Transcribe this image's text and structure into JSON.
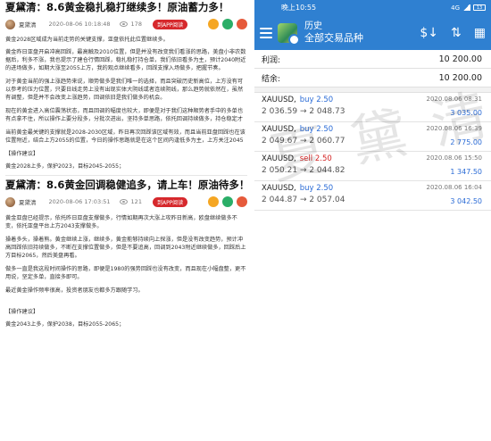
{
  "articles": [
    {
      "title": "夏黛清：8.6黄金稳扎稳打继续多！原油蓄力多！",
      "author": "夏黛清",
      "time": "2020-08-06 10:18:48",
      "views": "178",
      "app_label": "到APP阅读",
      "paragraphs": [
        "黄金2028区域成为当前走势的关键支撑，亚盘依托此位置继续多。",
        "黄金昨日亚盘开启冲高回踩，最高触及2010位置，但是并没有改变我们看涨的思路，美盘小非农数据后，利多不涨，我也提示了建仓行情回踩，稳扎稳打持仓单，我们依旧看多为主，预计2040附近的进场做多，如期大涨至2055上方，我的观点继续看多，回踩支撑入场做多，把握节奏。",
        "对于黄金当前的强上涨趋势来说，顺势做多是我们唯一的选择，而且突破历史新高位，上方没有可以参考的压力位置，只要日线走势上没有出现实体大阴线或者连续阴线，那么趋势就依然在，虽然有调整，但是并不会改变上涨趋势，回调依旧是我们做多的机会。",
        "现在的黄金进入高位震荡状态，而且回调的幅度也较大，即便是对于我们这种顺势者手中的多单也有点拿不住，所以操作上要分段多，分批次进出，坚持多单思路，依托回调持续做多，持仓稳定才能保证盈利稳定。",
        "当前黄金最关键的支撑就是2028-2030区域，昨日再次回踩该区域有效，而且当前亚盘回踩也在该位置附近，结合上方2055的位置，今日的操作思路就是在这个区间内逢低多为主，上方关注2045和2055压力。"
      ],
      "suggestion_label": "【操作建议】",
      "suggestion": "黄金2028上多，保护2023，目标2045-2055；"
    },
    {
      "title": "夏黛清：8.6黄金回调稳健追多，请上车！原油待多！",
      "author": "夏黛清",
      "time": "2020-08-06 17:03:51",
      "views": "121",
      "app_label": "到APP阅读",
      "paragraphs": [
        "黄金亚盘已经提示，依托昨日亚盘支撑做多，行情如期再次大涨上攻昨日新高，欧盘继续做多不变，依托亚盘平台上方2043支撑做多。",
        "操着多头，操着熊。黄金继续上涨，继续多，黄金能够持续向上探涨，但是没有改变趋势，预计冲高回踩依旧持续做多，不断在支撑位置做多，但是不要追高，回调到2043附近继续做多，回踩后上方目标2065，然后美盘再看。",
        "做多一直是我这段时间操作的思路，即便是1980的强势回踩也没有改变，而且现在小幅盘整，更不用说，坚定多单，直接多即可。",
        "最近黄金操作频率很高，投资者朋友也都多方跟随学习。"
      ],
      "suggestion_label": "【操作建议】",
      "suggestion": "黄金2043上多，保护2038，目标2055-2065；"
    }
  ],
  "phone": {
    "status_time": "晚上10:55",
    "status_icons": "4G",
    "battery": "13",
    "app_title": "历史",
    "app_subtitle": "全部交易品种",
    "summary": [
      {
        "label": "利润:",
        "value": "10 200.00"
      },
      {
        "label": "结余:",
        "value": "10 200.00"
      }
    ],
    "trades": [
      {
        "symbol": "XAUUSD,",
        "side": "buy",
        "lots": "2.50",
        "open": "2 036.59",
        "close": "2 048.73",
        "date": "2020.08.06 08:31",
        "profit": "3 035.00"
      },
      {
        "symbol": "XAUUSD,",
        "side": "buy",
        "lots": "2.50",
        "open": "2 049.67",
        "close": "2 060.77",
        "date": "2020.08.06 16:39",
        "profit": "2 775.00"
      },
      {
        "symbol": "XAUUSD,",
        "side": "sell",
        "lots": "2.50",
        "open": "2 050.21",
        "close": "2 044.82",
        "date": "2020.08.06 15:50",
        "profit": "1 347.50"
      },
      {
        "symbol": "XAUUSD,",
        "side": "buy",
        "lots": "2.50",
        "open": "2 044.87",
        "close": "2 057.04",
        "date": "2020.08.06 16:04",
        "profit": "3 042.50"
      }
    ]
  },
  "watermark": "夏黛清"
}
